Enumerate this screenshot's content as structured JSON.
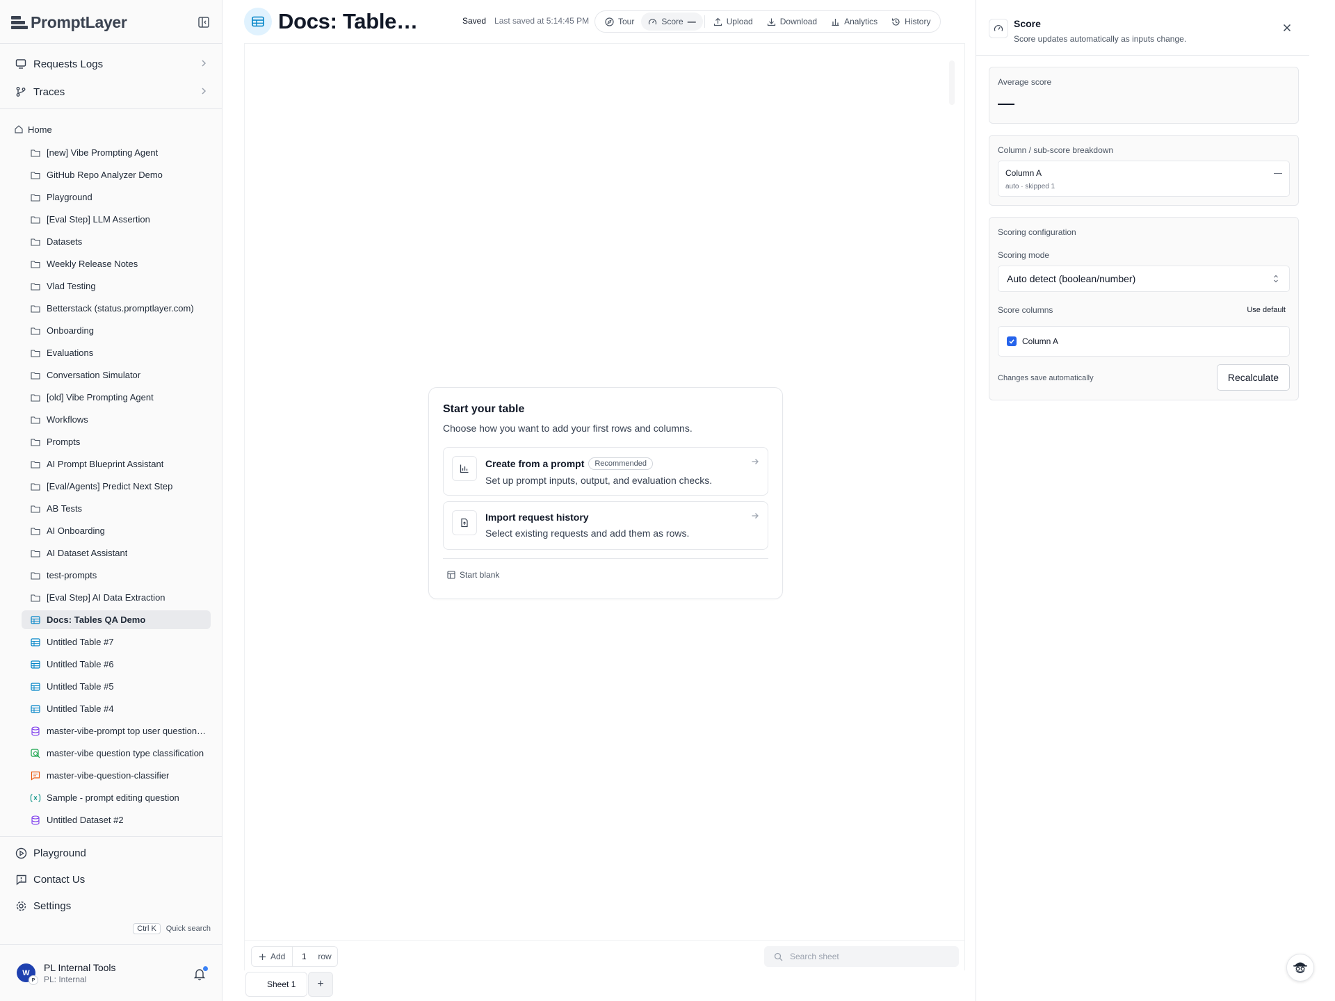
{
  "app": {
    "logo_text": "PromptLayer"
  },
  "sidebar": {
    "nav_top": [
      {
        "label": "Requests Logs",
        "icon": "monitor-icon"
      },
      {
        "label": "Traces",
        "icon": "git-branch-icon"
      }
    ],
    "home_label": "Home",
    "tree": [
      {
        "label": "[new] Vibe Prompting Agent",
        "type": "folder"
      },
      {
        "label": "GitHub Repo Analyzer Demo",
        "type": "folder"
      },
      {
        "label": "Playground",
        "type": "folder"
      },
      {
        "label": "[Eval Step] LLM Assertion",
        "type": "folder"
      },
      {
        "label": "Datasets",
        "type": "folder"
      },
      {
        "label": "Weekly Release Notes",
        "type": "folder"
      },
      {
        "label": "Vlad Testing",
        "type": "folder"
      },
      {
        "label": "Betterstack (status.promptlayer.com)",
        "type": "folder"
      },
      {
        "label": "Onboarding",
        "type": "folder"
      },
      {
        "label": "Evaluations",
        "type": "folder"
      },
      {
        "label": "Conversation Simulator",
        "type": "folder"
      },
      {
        "label": "[old] Vibe Prompting Agent",
        "type": "folder"
      },
      {
        "label": "Workflows",
        "type": "folder"
      },
      {
        "label": "Prompts",
        "type": "folder"
      },
      {
        "label": "AI Prompt Blueprint Assistant",
        "type": "folder"
      },
      {
        "label": "[Eval/Agents] Predict Next Step",
        "type": "folder"
      },
      {
        "label": "AB Tests",
        "type": "folder"
      },
      {
        "label": "AI Onboarding",
        "type": "folder"
      },
      {
        "label": "AI Dataset Assistant",
        "type": "folder"
      },
      {
        "label": "test-prompts",
        "type": "folder"
      },
      {
        "label": "[Eval Step] AI Data Extraction",
        "type": "folder"
      },
      {
        "label": "Docs: Tables QA Demo",
        "type": "table",
        "active": true
      },
      {
        "label": "Untitled Table #7",
        "type": "table"
      },
      {
        "label": "Untitled Table #6",
        "type": "table"
      },
      {
        "label": "Untitled Table #5",
        "type": "table"
      },
      {
        "label": "Untitled Table #4",
        "type": "table"
      },
      {
        "label": "master-vibe-prompt top user question…",
        "type": "dataset"
      },
      {
        "label": "master-vibe question type classification",
        "type": "eval"
      },
      {
        "label": "master-vibe-question-classifier",
        "type": "prompt"
      },
      {
        "label": "Sample - prompt editing question",
        "type": "variable"
      },
      {
        "label": "Untitled Dataset #2",
        "type": "dataset"
      }
    ],
    "nav_bottom": [
      {
        "label": "Playground",
        "icon": "play-circle-icon"
      },
      {
        "label": "Contact Us",
        "icon": "message-alert-icon"
      },
      {
        "label": "Settings",
        "icon": "gear-icon"
      }
    ],
    "quick_search": {
      "kbd": "Ctrl K",
      "label": "Quick search"
    },
    "user": {
      "initial": "W",
      "org_initial": "P",
      "name": "PL Internal Tools",
      "org": "PL: Internal"
    }
  },
  "main": {
    "title": "Docs: Table…",
    "saved_label": "Saved",
    "last_saved": "Last saved at 5:14:45 PM",
    "toolbar": [
      {
        "label": "Tour",
        "icon": "compass-icon"
      },
      {
        "label": "Score",
        "icon": "gauge-icon",
        "value": "—"
      },
      {
        "label": "Upload",
        "icon": "upload-icon"
      },
      {
        "label": "Download",
        "icon": "download-icon"
      },
      {
        "label": "Analytics",
        "icon": "bar-chart-icon"
      },
      {
        "label": "History",
        "icon": "history-icon"
      }
    ],
    "start_card": {
      "title": "Start your table",
      "subtitle": "Choose how you want to add your first rows and columns.",
      "options": [
        {
          "title": "Create from a prompt",
          "badge": "Recommended",
          "desc": "Set up prompt inputs, output, and evaluation checks.",
          "icon": "chart-icon"
        },
        {
          "title": "Import request history",
          "desc": "Select existing requests and add them as rows.",
          "icon": "file-import-icon"
        }
      ],
      "blank_label": "Start blank"
    },
    "bottom": {
      "add_label": "Add",
      "row_count": "1",
      "row_unit": "row",
      "search_placeholder": "Search sheet"
    },
    "sheets": [
      "Sheet 1"
    ],
    "add_sheet_label": "+"
  },
  "score_panel": {
    "title": "Score",
    "subtitle": "Score updates automatically as inputs change.",
    "average_label": "Average score",
    "average_value": "—",
    "breakdown_label": "Column / sub-score breakdown",
    "breakdown": [
      {
        "name": "Column A",
        "meta": "auto · skipped 1",
        "value": "—"
      }
    ],
    "config_label": "Scoring configuration",
    "mode_label": "Scoring mode",
    "mode_value": "Auto detect (boolean/number)",
    "columns_label": "Score columns",
    "use_default_label": "Use default",
    "columns": [
      {
        "name": "Column A",
        "checked": true
      }
    ],
    "autosave_note": "Changes save automatically",
    "recalculate_label": "Recalculate"
  }
}
